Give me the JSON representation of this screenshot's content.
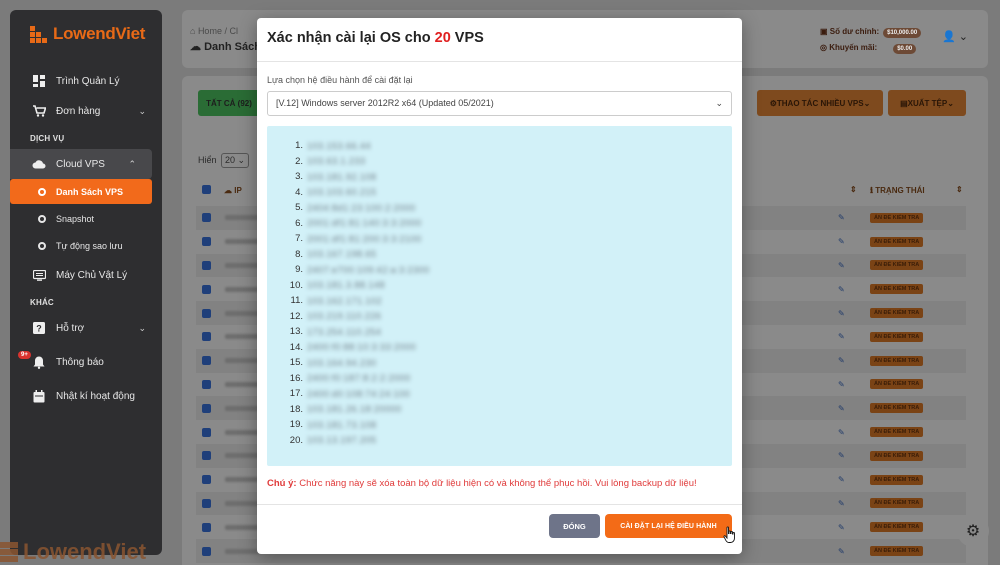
{
  "sidebar": {
    "brand": "LowendViet",
    "items": [
      {
        "label": "Trình Quản Lý"
      },
      {
        "label": "Đơn hàng"
      }
    ],
    "section_services": "DỊCH VỤ",
    "cloud_vps": "Cloud VPS",
    "sub_items": [
      {
        "label": "Danh Sách VPS"
      },
      {
        "label": "Snapshot"
      },
      {
        "label": "Tự động sao lưu"
      }
    ],
    "dedicated": "Máy Chủ Vật Lý",
    "section_other": "KHÁC",
    "support": "Hỗ trợ",
    "notifications": "Thông báo",
    "notifications_badge": "9+",
    "activity_log": "Nhật kí hoạt động",
    "watermark": "LowendViet"
  },
  "header": {
    "breadcrumb": "Home / Cl",
    "page_title": "Danh Sách",
    "balance_label": "Số dư chính:",
    "balance_value": "$10,000.00",
    "promo_label": "Khuyến mãi:",
    "promo_value": "$0.00"
  },
  "toolbar": {
    "tab_all": "TẤT CẢ (92)",
    "multi_action": "THAO TÁC NHIỀU VPS",
    "export": "XUẤT TỆP"
  },
  "table": {
    "show_label": "Hiển",
    "page_size": "20",
    "col_ip": "IP",
    "col_status": "TRẠNG THÁI",
    "status_text": "ẨN ĐỂ KIỂM TRA"
  },
  "modal": {
    "title_prefix": "Xác nhận cài lại OS cho ",
    "title_count": "20",
    "title_suffix": " VPS",
    "select_label": "Lựa chọn hệ điều hành để cài đặt lại",
    "selected_os": "[V.12] Windows server 2012R2 x64 (Updated 05/2021)",
    "ip_list": [
      {
        "n": "1.",
        "ip": "103.153.66.44"
      },
      {
        "n": "2.",
        "ip": "103.63.1.233"
      },
      {
        "n": "3.",
        "ip": "103.181.92.108"
      },
      {
        "n": "4.",
        "ip": "103.103.60.215"
      },
      {
        "n": "5.",
        "ip": "2404:8d1:23:100:2:2000"
      },
      {
        "n": "6.",
        "ip": "2001:df1:81:140:3:3:2000"
      },
      {
        "n": "7.",
        "ip": "2001:df1:81:200:3:3:2100"
      },
      {
        "n": "8.",
        "ip": "103.167.198.65"
      },
      {
        "n": "9.",
        "ip": "2407:e700:109:42:a:3:2300"
      },
      {
        "n": "10.",
        "ip": "103.181.3.88.148"
      },
      {
        "n": "11.",
        "ip": "103.162.171.102"
      },
      {
        "n": "12.",
        "ip": "103.219.110.226"
      },
      {
        "n": "13.",
        "ip": "173.254.110.254"
      },
      {
        "n": "14.",
        "ip": "2400:f0:88:10:3:33:2000"
      },
      {
        "n": "15.",
        "ip": "103.164.94.230"
      },
      {
        "n": "16.",
        "ip": "2400:f0:187:8:2:2:2000"
      },
      {
        "n": "17.",
        "ip": "2400:d0:108:74:24:100"
      },
      {
        "n": "18.",
        "ip": "103.181.26.18:20000"
      },
      {
        "n": "19.",
        "ip": "103.181.73.108"
      },
      {
        "n": "20.",
        "ip": "103.13.197.205"
      }
    ],
    "warning_label": "Chú ý:",
    "warning_text": " Chức năng này sẽ xóa toàn bộ dữ liệu hiện có và không thể phục hồi. Vui lòng backup dữ liệu!",
    "close_label": "ĐÓNG",
    "confirm_label": "CÀI ĐẶT LẠI HỆ ĐIỀU HÀNH"
  },
  "colors": {
    "accent": "#f36b17",
    "danger": "#e02020",
    "sidebar_bg": "#2e2e30",
    "info_box": "#d2f1f8"
  }
}
